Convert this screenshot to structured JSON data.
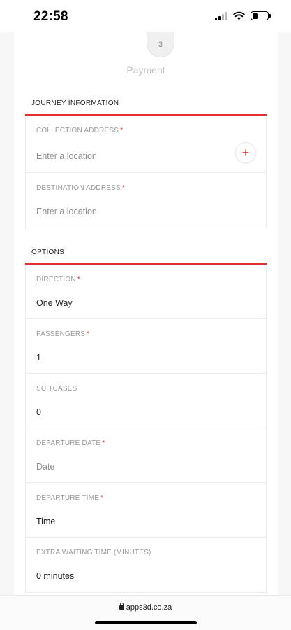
{
  "status_bar": {
    "time": "22:58",
    "icons": [
      "signal-icon",
      "wifi-icon",
      "battery-icon"
    ],
    "battery_level": 0.35
  },
  "stepper": {
    "step_number": "3",
    "step_label": "Payment"
  },
  "journey": {
    "title": "JOURNEY INFORMATION",
    "fields": [
      {
        "label": "COLLECTION ADDRESS",
        "required": true,
        "placeholder": "Enter a location",
        "value": ""
      },
      {
        "label": "DESTINATION ADDRESS",
        "required": true,
        "placeholder": "Enter a location",
        "value": ""
      }
    ],
    "add_button_label": "+"
  },
  "options": {
    "title": "OPTIONS",
    "fields": [
      {
        "label": "DIRECTION",
        "required": true,
        "value": "One Way"
      },
      {
        "label": "PASSENGERS",
        "required": true,
        "value": "1"
      },
      {
        "label": "SUITCASES",
        "required": false,
        "value": "0"
      },
      {
        "label": "DEPARTURE DATE",
        "required": true,
        "placeholder": "Date",
        "value": ""
      },
      {
        "label": "DEPARTURE TIME",
        "required": true,
        "value": "Time"
      },
      {
        "label": "EXTRA WAITING TIME (MINUTES)",
        "required": false,
        "value": "0 minutes"
      }
    ]
  },
  "browser": {
    "url": "apps3d.co.za"
  },
  "colors": {
    "accent": "#e0312f",
    "label": "#9a9a9a",
    "placeholder": "#8f8f8f"
  }
}
